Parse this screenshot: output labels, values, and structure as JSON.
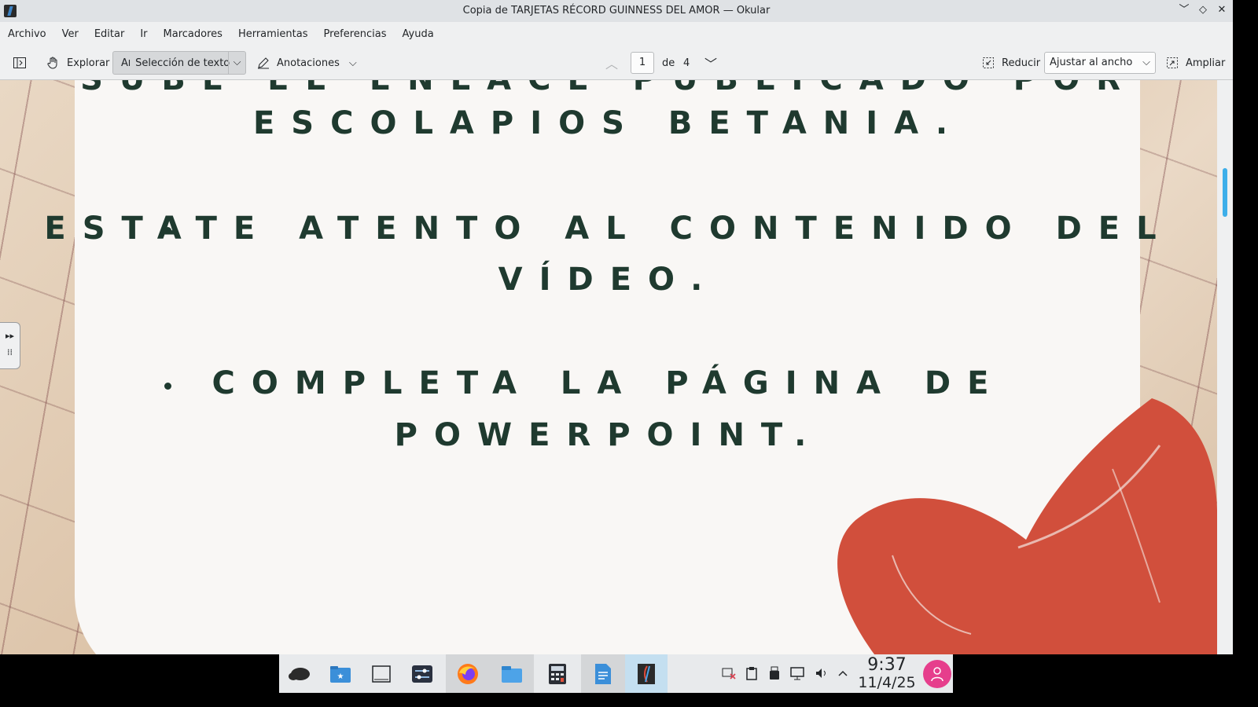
{
  "window": {
    "title": "Copia de TARJETAS RÉCORD GUINNESS DEL AMOR — Okular",
    "app_icon": "okular-icon",
    "controls": [
      "minimize-icon",
      "maximize-icon",
      "close-icon"
    ]
  },
  "menu": {
    "items": [
      "Archivo",
      "Ver",
      "Editar",
      "Ir",
      "Marcadores",
      "Herramientas",
      "Preferencias",
      "Ayuda"
    ]
  },
  "toolbar": {
    "browse_label": "Explorar",
    "text_select_label": "Selección de texto",
    "annotations_label": "Anotaciones",
    "page_current": "1",
    "page_of_label": "de",
    "page_total": "4",
    "zoom_out_label": "Reducir",
    "zoom_mode": "Ajustar al ancho",
    "zoom_in_label": "Ampliar"
  },
  "document": {
    "line_top_partial": "SUBE EL ENLACE PUBLICADO POR",
    "line_top": "ESCOLAPIOS BETANIA.",
    "bullet1_line1": "ESTATE ATENTO AL CONTENIDO DEL",
    "bullet1_line2": "VÍDEO.",
    "bullet2_line1": "COMPLETA LA PÁGINA DE",
    "bullet2_line2": "POWERPOINT.",
    "text_color": "#1f3a2f",
    "heart_color": "#d14f3c"
  },
  "taskbar": {
    "apps": [
      "plasma-launcher-icon",
      "file-manager-icon",
      "terminal-icon",
      "system-settings-icon",
      "firefox-icon",
      "folder-icon",
      "calculator-icon",
      "text-editor-icon",
      "okular-icon"
    ],
    "tray": [
      "network-disconnected-icon",
      "clipboard-icon",
      "usb-drive-icon",
      "display-icon",
      "volume-icon",
      "expand-tray-icon"
    ],
    "time": "9:37",
    "date": "11/4/25",
    "accent": "#3daee9"
  }
}
